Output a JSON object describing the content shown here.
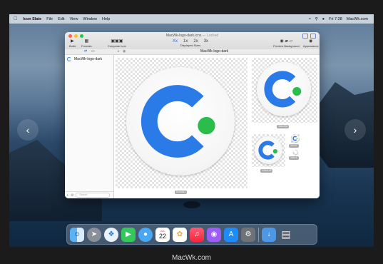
{
  "menubar": {
    "app_name": "Icon Slate",
    "items": [
      "File",
      "Edit",
      "View",
      "Window",
      "Help"
    ],
    "clock": "Fri 7:28",
    "site": "MacWk.com"
  },
  "window": {
    "title": "MacWk-logo-dark.icns",
    "title_status": "— Locked",
    "toolbar": {
      "build": "Build",
      "formats": "Formats",
      "compose": "Compose Icon",
      "displayed_sizes": "Displayed Sizes",
      "sizes": [
        "Xx",
        "1x",
        "2x",
        "3x"
      ],
      "preview_background": "Preview Background",
      "appearance": "Appearance"
    },
    "canvas_title": "MacWk-logo-dark",
    "sidebar": {
      "items": [
        {
          "label": "MacWk-logo-dark"
        }
      ],
      "search_placeholder": "Search"
    },
    "previews": [
      {
        "label": "512x512"
      },
      {
        "label": "256x256"
      },
      {
        "label": "128x128"
      },
      {
        "label": "32x32"
      },
      {
        "label": "16x16"
      }
    ]
  },
  "colors": {
    "accent_blue": "#2e6bd8",
    "logo_blue": "#2a7ae8",
    "logo_green": "#2bbd4c"
  },
  "dock": {
    "icons": [
      "finder-icon",
      "launchpad-icon",
      "safari-icon",
      "facetime-icon",
      "messages-icon",
      "calendar-icon",
      "photos-icon",
      "music-icon",
      "podcasts-icon",
      "app-store-icon",
      "system-preferences-icon",
      "downloads-folder-icon",
      "trash-icon"
    ],
    "calendar_month": "JUL",
    "calendar_day": "22"
  },
  "watermark": "MacWk.com"
}
